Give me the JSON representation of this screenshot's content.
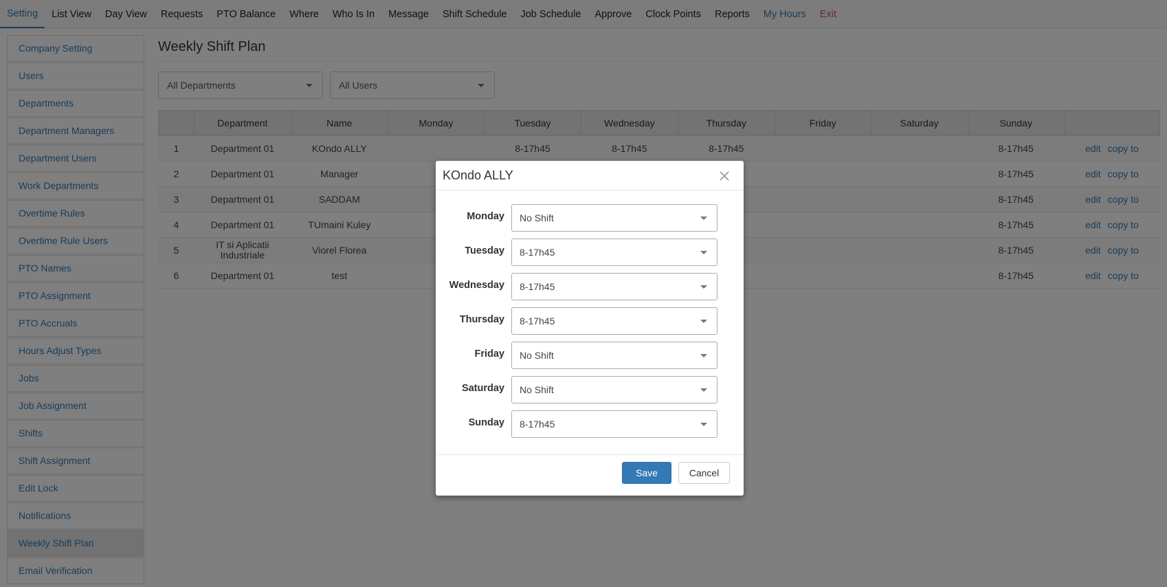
{
  "topnav": [
    {
      "label": "Setting",
      "style": "active"
    },
    {
      "label": "List View",
      "style": ""
    },
    {
      "label": "Day View",
      "style": ""
    },
    {
      "label": "Requests",
      "style": ""
    },
    {
      "label": "PTO Balance",
      "style": ""
    },
    {
      "label": "Where",
      "style": ""
    },
    {
      "label": "Who Is In",
      "style": ""
    },
    {
      "label": "Message",
      "style": ""
    },
    {
      "label": "Shift Schedule",
      "style": ""
    },
    {
      "label": "Job Schedule",
      "style": ""
    },
    {
      "label": "Approve",
      "style": ""
    },
    {
      "label": "Clock Points",
      "style": ""
    },
    {
      "label": "Reports",
      "style": ""
    },
    {
      "label": "My Hours",
      "style": "blue"
    },
    {
      "label": "Exit",
      "style": "red"
    }
  ],
  "sidebar": [
    "Company Setting",
    "Users",
    "Departments",
    "Department Managers",
    "Department Users",
    "Work Departments",
    "Overtime Rules",
    "Overtime Rule Users",
    "PTO Names",
    "PTO Assignment",
    "PTO Accruals",
    "Hours Adjust Types",
    "Jobs",
    "Job Assignment",
    "Shifts",
    "Shift Assignment",
    "Edit Lock",
    "Notifications",
    "Weekly Shift Plan",
    "Email Verification"
  ],
  "sidebar_active": "Weekly Shift Plan",
  "page": {
    "title": "Weekly Shift Plan",
    "department_filter": "All Departments",
    "user_filter": "All Users"
  },
  "table": {
    "headers": [
      "",
      "Department",
      "Name",
      "Monday",
      "Tuesday",
      "Wednesday",
      "Thursday",
      "Friday",
      "Saturday",
      "Sunday",
      ""
    ],
    "rows": [
      [
        "1",
        "Department 01",
        "KOndo ALLY",
        "",
        "8-17h45",
        "8-17h45",
        "8-17h45",
        "",
        "",
        "8-17h45"
      ],
      [
        "2",
        "Department 01",
        "Manager",
        "",
        "",
        "",
        "",
        "",
        "",
        "8-17h45"
      ],
      [
        "3",
        "Department 01",
        "SADDAM",
        "",
        "",
        "",
        "",
        "",
        "",
        "8-17h45"
      ],
      [
        "4",
        "Department 01",
        "TUmaini Kuley",
        "",
        "",
        "",
        "",
        "",
        "",
        "8-17h45"
      ],
      [
        "5",
        "IT si Aplicatii Industriale",
        "Viorel Florea",
        "",
        "",
        "",
        "",
        "",
        "",
        "8-17h45"
      ],
      [
        "6",
        "Department 01",
        "test",
        "",
        "",
        "",
        "",
        "",
        "",
        "8-17h45"
      ]
    ],
    "edit_label": "edit",
    "copy_label": "copy to"
  },
  "modal": {
    "title": "KOndo ALLY",
    "days": [
      {
        "label": "Monday",
        "value": "No Shift"
      },
      {
        "label": "Tuesday",
        "value": "8-17h45"
      },
      {
        "label": "Wednesday",
        "value": "8-17h45"
      },
      {
        "label": "Thursday",
        "value": "8-17h45"
      },
      {
        "label": "Friday",
        "value": "No Shift"
      },
      {
        "label": "Saturday",
        "value": "No Shift"
      },
      {
        "label": "Sunday",
        "value": "8-17h45"
      }
    ],
    "save_label": "Save",
    "cancel_label": "Cancel"
  }
}
